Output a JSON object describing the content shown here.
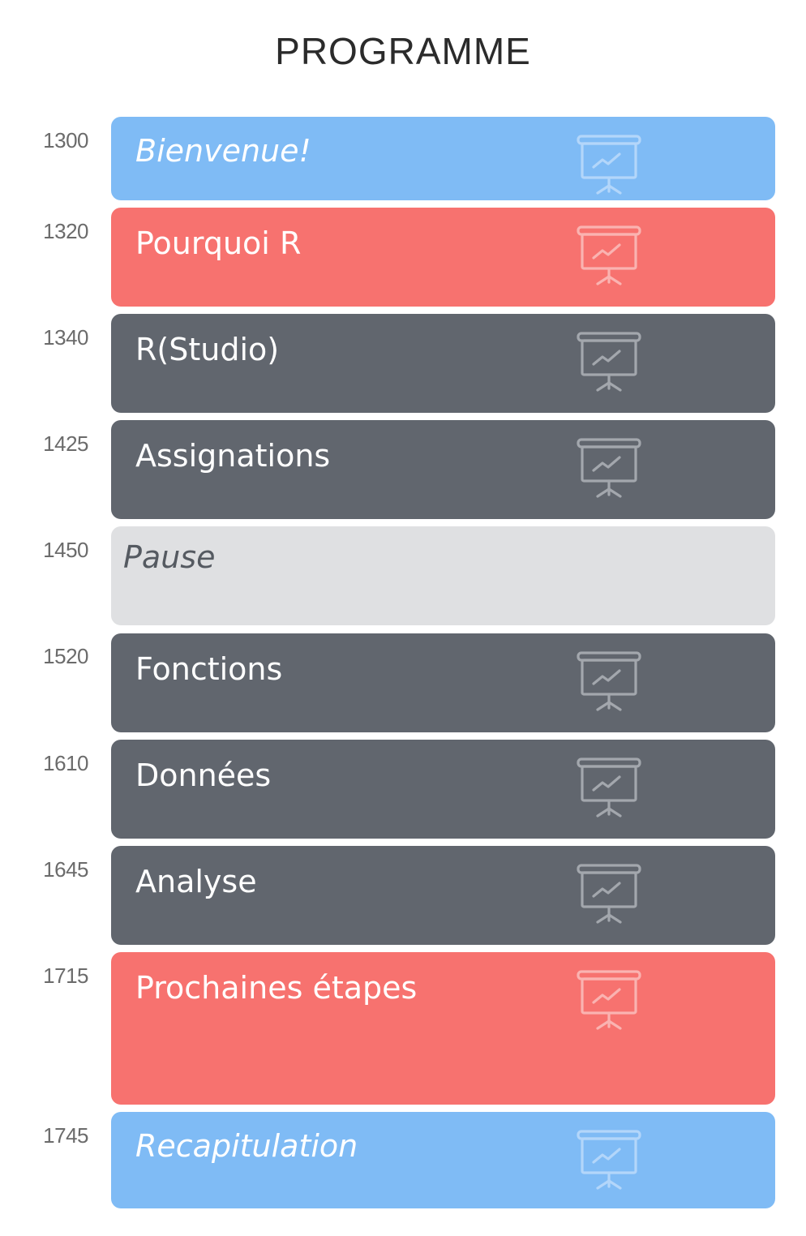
{
  "page": {
    "title": "PROGRAMME"
  },
  "colors": {
    "blue": "#7fbbf5",
    "red": "#f7726f",
    "dark": "#61666e",
    "light": "#dfe0e2"
  },
  "schedule": [
    {
      "time": "1300",
      "label": "Bienvenue!",
      "color": "blue",
      "italic": true,
      "icon": "presentation-icon"
    },
    {
      "time": "1320",
      "label": "Pourquoi R",
      "color": "red",
      "italic": false,
      "icon": "presentation-icon"
    },
    {
      "time": "1340",
      "label": "R(Studio)",
      "color": "dark",
      "italic": false,
      "icon": "presentation-icon"
    },
    {
      "time": "1425",
      "label": "Assignations",
      "color": "dark",
      "italic": false,
      "icon": "presentation-icon"
    },
    {
      "time": "1450",
      "label": "Pause",
      "color": "light",
      "italic": true,
      "icon": ""
    },
    {
      "time": "1520",
      "label": "Fonctions",
      "color": "dark",
      "italic": false,
      "icon": "presentation-icon"
    },
    {
      "time": "1610",
      "label": "Données",
      "color": "dark",
      "italic": false,
      "icon": "presentation-icon"
    },
    {
      "time": "1645",
      "label": "Analyse",
      "color": "dark",
      "italic": false,
      "icon": "presentation-icon"
    },
    {
      "time": "1715",
      "label": "Prochaines étapes",
      "color": "red",
      "italic": false,
      "icon": "presentation-icon"
    },
    {
      "time": "1745",
      "label": "Recapitulation",
      "color": "blue",
      "italic": true,
      "icon": "presentation-icon"
    }
  ]
}
